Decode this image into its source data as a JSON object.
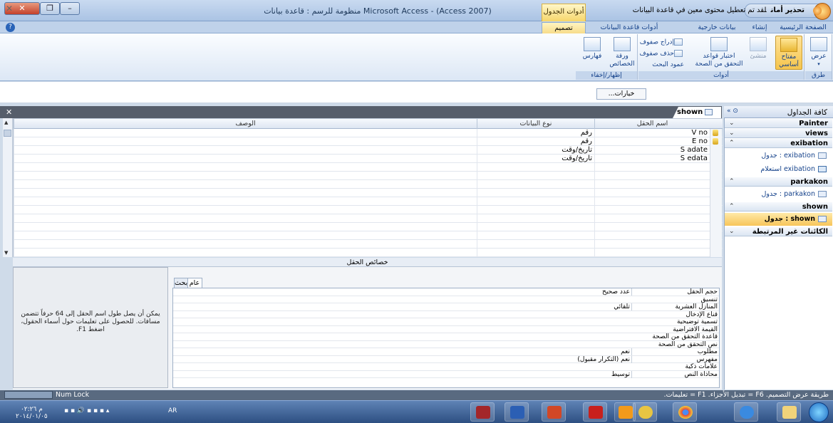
{
  "window": {
    "title": "Microsoft Access - (Access 2007) منظومة للرسم : قاعدة بيانات",
    "context_tab_group": "أدوات الجدول"
  },
  "ribbon_tabs": [
    {
      "label": "الصفحة الرئيسية"
    },
    {
      "label": "إنشاء"
    },
    {
      "label": "بيانات خارجية"
    },
    {
      "label": "أدوات قاعدة البيانات"
    },
    {
      "label": "تصميم"
    }
  ],
  "ribbon": {
    "views_group": {
      "caption": "طرق عرض",
      "view_label": "عرض"
    },
    "tools_group": {
      "caption": "أدوات",
      "primary_key": "مفتاح أساسي",
      "builder": "منشئ",
      "test_rules": "اختبار قواعد التحقق من الصحة",
      "insert_rows": "إدراج صفوف",
      "delete_rows": "حذف صفوف",
      "lookup_column": "عمود البحث"
    },
    "show_hide_group": {
      "caption": "إظهار/إخفاء",
      "property_sheet": "ورقة الخصائص",
      "indexes": "فهارس"
    }
  },
  "security_bar": {
    "title": "تحذير أمان",
    "message": "لقد تم تعطيل محتوى معين في قاعدة البيانات",
    "options_button": "خيارات..."
  },
  "document_tab": {
    "name": "shown"
  },
  "design_grid": {
    "headers": {
      "field_name": "اسم الحقل",
      "data_type": "نوع البيانات",
      "description": "الوصف"
    },
    "rows": [
      {
        "field": "V no",
        "type": "رقم",
        "desc": "",
        "pk": true
      },
      {
        "field": "E no",
        "type": "رقم",
        "desc": "",
        "pk": true
      },
      {
        "field": "S adate",
        "type": "تاريخ/وقت",
        "desc": "",
        "pk": false
      },
      {
        "field": "S edata",
        "type": "تاريخ/وقت",
        "desc": "",
        "pk": false
      }
    ]
  },
  "field_properties": {
    "label": "خصائص الحقل",
    "tabs": [
      {
        "label": "عام"
      },
      {
        "label": "بحث"
      }
    ],
    "rows": [
      {
        "label": "حجم الحقل",
        "value": "عدد صحيح"
      },
      {
        "label": "تنسيق",
        "value": ""
      },
      {
        "label": "المنازل العشرية",
        "value": "تلقائي"
      },
      {
        "label": "قناع الإدخال",
        "value": ""
      },
      {
        "label": "تسمية توضيحية",
        "value": ""
      },
      {
        "label": "القيمة الافتراضية",
        "value": ""
      },
      {
        "label": "قاعدة التحقق من الصحة",
        "value": ""
      },
      {
        "label": "نص التحقق من الصحة",
        "value": ""
      },
      {
        "label": "مطلوب",
        "value": "نعم"
      },
      {
        "label": "مفهرس",
        "value": "نعم (التكرار مقبول)"
      },
      {
        "label": "علامات ذكية",
        "value": ""
      },
      {
        "label": "محاذاة النص",
        "value": "توسيط"
      }
    ],
    "help_text": "يمكن أن يصل طول اسم الحقل إلى 64 حرفاً تتضمن مسافات. للحصول على تعليمات حول أسماء الحقول، اضغط F1."
  },
  "nav_pane": {
    "title": "كافة الجداول",
    "groups": [
      {
        "name": "Painter",
        "expanded": false,
        "items": []
      },
      {
        "name": "views",
        "expanded": false,
        "items": []
      },
      {
        "name": "exibation",
        "expanded": true,
        "items": [
          {
            "label": "exibation : جدول",
            "icon": "table-icon",
            "selected": false
          },
          {
            "label": "exibation استعلام",
            "icon": "query-icon",
            "selected": false
          }
        ]
      },
      {
        "name": "parkakon",
        "expanded": true,
        "items": [
          {
            "label": "parkakon : جدول",
            "icon": "table-icon",
            "selected": false
          }
        ]
      },
      {
        "name": "shown",
        "expanded": true,
        "items": [
          {
            "label": "shown : جدول",
            "icon": "table-icon",
            "selected": true
          }
        ]
      },
      {
        "name": "الكائنات غير المرتبطة",
        "expanded": false,
        "items": []
      }
    ]
  },
  "status_bar": {
    "text": "طريقة عرض التصميم. F6 = تبديل الأجزاء. F1 = تعليمات.",
    "num_lock": "Num Lock"
  },
  "taskbar": {
    "clock_time": "م ٠٢:٢٦",
    "clock_date": "٢٠١٤/٠١/٠٥",
    "language": "AR"
  },
  "colors": {
    "accent": "#f7c55a",
    "tab_bar": "#565e6b",
    "status_bar": "#596a80"
  }
}
